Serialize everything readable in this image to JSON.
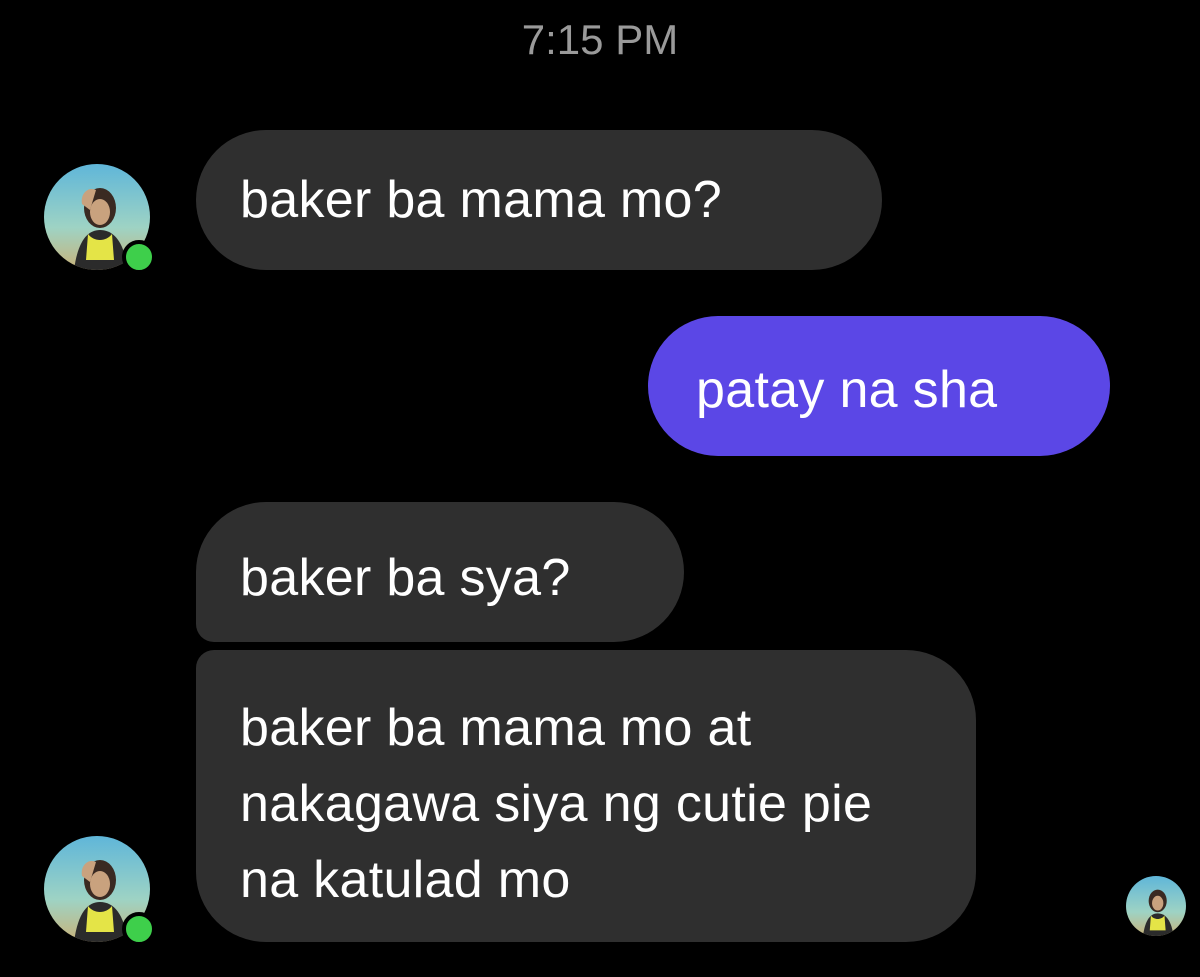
{
  "chat": {
    "timestamp": "7:15 PM",
    "messages": [
      {
        "sender": "contact",
        "text": "baker ba mama mo?"
      },
      {
        "sender": "me",
        "text": "patay na sha"
      },
      {
        "sender": "contact",
        "text": "baker ba sya?"
      },
      {
        "sender": "contact",
        "text": "baker ba mama mo at nakagawa siya ng cutie pie na katulad mo"
      }
    ]
  },
  "colors": {
    "background": "#000000",
    "incoming_bubble": "#2f2f2f",
    "outgoing_bubble": "#5b47e6",
    "online_indicator": "#3ecf4b"
  },
  "icons": {
    "contact_avatar": "contact-avatar-photo",
    "online_status": "online-dot",
    "seen_receipt": "seen-avatar"
  }
}
